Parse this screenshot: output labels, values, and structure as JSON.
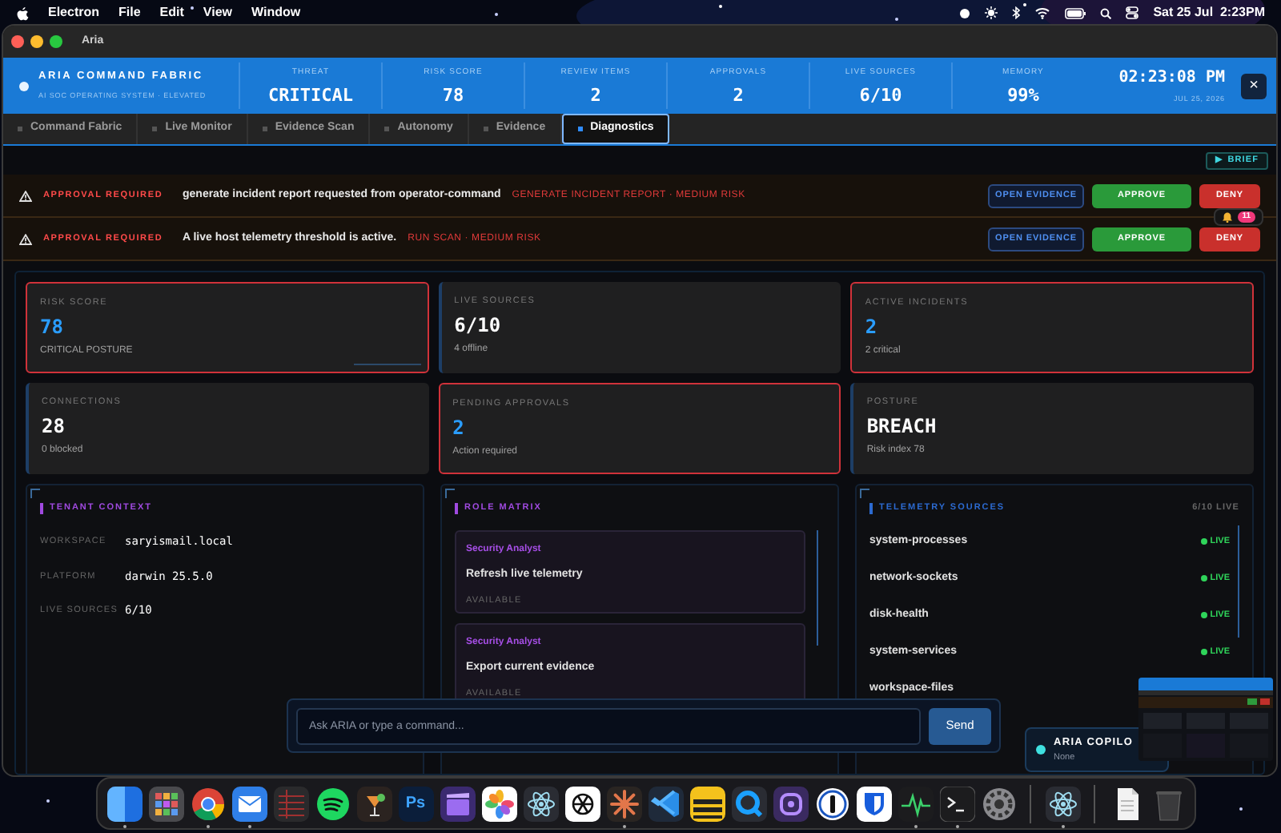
{
  "menu_bar": {
    "app": "Electron",
    "menus": [
      "File",
      "Edit",
      "View",
      "Window"
    ],
    "clock": "Sat 25 Jul  2:23PM"
  },
  "window": {
    "title": "Aria"
  },
  "header": {
    "brand": "ARIA COMMAND FABRIC",
    "subtitle": "AI SOC OPERATING SYSTEM · ELEVATED",
    "stats": [
      {
        "label": "THREAT",
        "value": "CRITICAL"
      },
      {
        "label": "RISK SCORE",
        "value": "78"
      },
      {
        "label": "REVIEW ITEMS",
        "value": "2"
      },
      {
        "label": "APPROVALS",
        "value": "2"
      },
      {
        "label": "LIVE SOURCES",
        "value": "6/10"
      },
      {
        "label": "MEMORY",
        "value": "99%"
      }
    ],
    "time": "02:23:08 PM",
    "date": "JUL 25, 2026",
    "close": "×"
  },
  "tabs": [
    {
      "label": "Command Fabric",
      "selected": false
    },
    {
      "label": "Live Monitor",
      "selected": false
    },
    {
      "label": "Evidence Scan",
      "selected": false
    },
    {
      "label": "Autonomy",
      "selected": false
    },
    {
      "label": "Evidence",
      "selected": false
    },
    {
      "label": "Diagnostics",
      "selected": true
    }
  ],
  "brief_button": "▶ BRIEF",
  "approvals": [
    {
      "tag": "APPROVAL REQUIRED",
      "message": "generate incident report requested from operator-command",
      "risk": "GENERATE INCIDENT REPORT · MEDIUM RISK",
      "actions": [
        "OPEN EVIDENCE",
        "APPROVE",
        "DENY"
      ]
    },
    {
      "tag": "APPROVAL REQUIRED",
      "message": "A live host telemetry threshold is active.",
      "risk": "RUN SCAN · MEDIUM RISK",
      "actions": [
        "OPEN EVIDENCE",
        "APPROVE",
        "DENY"
      ]
    }
  ],
  "notification_badge": {
    "count": "11"
  },
  "cards": [
    {
      "label": "RISK SCORE",
      "value": "78",
      "detail": "CRITICAL POSTURE",
      "alert": true,
      "highlight": true
    },
    {
      "label": "LIVE SOURCES",
      "value": "6/10",
      "detail": "4 offline",
      "alert": false,
      "highlight": false
    },
    {
      "label": "ACTIVE INCIDENTS",
      "value": "2",
      "detail": "2 critical",
      "alert": true,
      "highlight": true
    },
    {
      "label": "CONNECTIONS",
      "value": "28",
      "detail": "0 blocked",
      "alert": false,
      "highlight": false
    },
    {
      "label": "PENDING APPROVALS",
      "value": "2",
      "detail": "Action required",
      "alert": true,
      "highlight": true
    },
    {
      "label": "POSTURE",
      "value": "BREACH",
      "detail": "Risk index 78",
      "alert": false,
      "highlight": false
    }
  ],
  "tenant_context": {
    "title": "TENANT CONTEXT",
    "rows": [
      {
        "label": "WORKSPACE",
        "value": "saryismail.local"
      },
      {
        "label": "PLATFORM",
        "value": "darwin 25.5.0"
      },
      {
        "label": "LIVE SOURCES",
        "value": "6/10"
      }
    ]
  },
  "role_matrix": {
    "title": "ROLE MATRIX",
    "items": [
      {
        "role": "Security Analyst",
        "action": "Refresh live telemetry",
        "status": "AVAILABLE"
      },
      {
        "role": "Security Analyst",
        "action": "Export current evidence",
        "status": "AVAILABLE"
      }
    ]
  },
  "telemetry_sources": {
    "title": "TELEMETRY SOURCES",
    "summary": "6/10 LIVE",
    "sources": [
      {
        "name": "system-processes",
        "status": "LIVE"
      },
      {
        "name": "network-sockets",
        "status": "LIVE"
      },
      {
        "name": "disk-health",
        "status": "LIVE"
      },
      {
        "name": "system-services",
        "status": "LIVE"
      },
      {
        "name": "workspace-files"
      }
    ]
  },
  "command_bar": {
    "placeholder": "Ask ARIA or type a command...",
    "button": "Send"
  },
  "copilot": {
    "title": "ARIA COPILO",
    "status": "None"
  },
  "dock": [
    {
      "kind": "finder",
      "running": true
    },
    {
      "kind": "launchpad",
      "running": false
    },
    {
      "kind": "chrome",
      "running": true
    },
    {
      "kind": "mail",
      "running": true
    },
    {
      "kind": "lined",
      "running": false
    },
    {
      "kind": "spotify",
      "running": false
    },
    {
      "kind": "glass",
      "running": false
    },
    {
      "kind": "lettered",
      "label": "Ps",
      "running": false
    },
    {
      "kind": "clapper",
      "running": false
    },
    {
      "kind": "flower",
      "running": false
    },
    {
      "kind": "atom",
      "running": false
    },
    {
      "kind": "knot",
      "running": false
    },
    {
      "kind": "asterisk",
      "running": true
    },
    {
      "kind": "ribbon",
      "running": false
    },
    {
      "kind": "stack",
      "running": false
    },
    {
      "kind": "magnifier",
      "running": false
    },
    {
      "kind": "lock",
      "running": false
    },
    {
      "kind": "keyhole",
      "running": false
    },
    {
      "kind": "shield",
      "running": false
    },
    {
      "kind": "pulse",
      "running": true
    },
    {
      "kind": "terminal",
      "running": true
    },
    {
      "kind": "gear",
      "running": false
    },
    {
      "kind": "divider"
    },
    {
      "kind": "atom",
      "running": true
    },
    {
      "kind": "divider"
    },
    {
      "kind": "document",
      "running": false
    },
    {
      "kind": "trash",
      "running": false
    }
  ]
}
